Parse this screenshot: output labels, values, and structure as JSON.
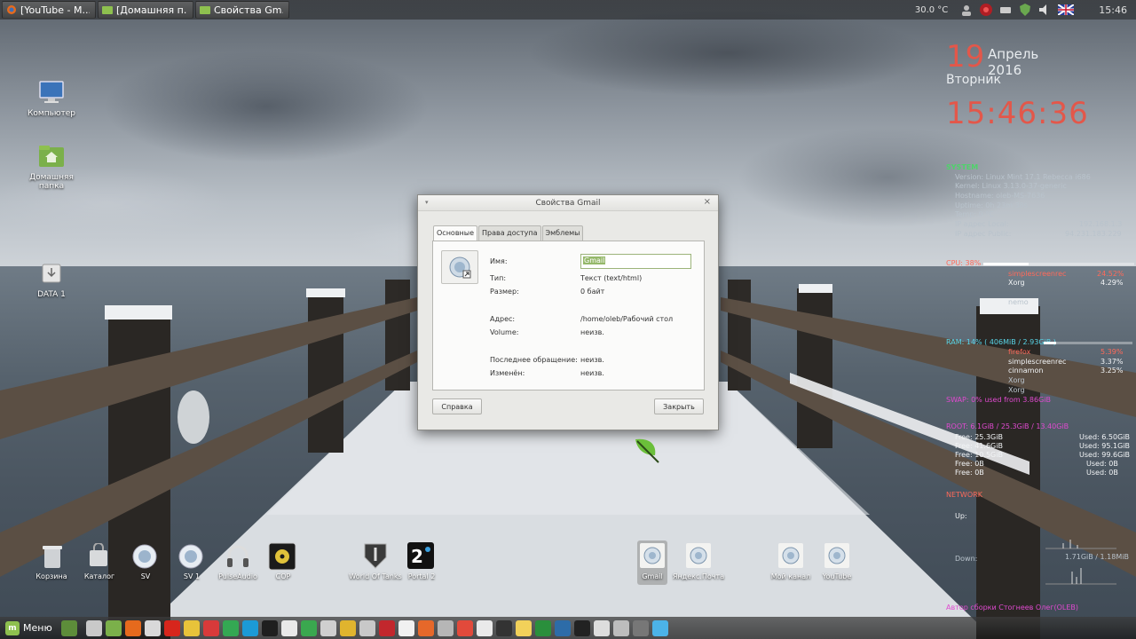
{
  "top_panel": {
    "windows": [
      {
        "label": "[YouTube - M..."
      },
      {
        "label": "[Домашняя п..."
      },
      {
        "label": "Свойства Gm..."
      }
    ],
    "temperature": "30.0 °C",
    "time": "15:46"
  },
  "desktop_icons": [
    {
      "label": "Компьютер"
    },
    {
      "label": "Домашняя папка"
    },
    {
      "label": "DATA 1"
    }
  ],
  "dialog": {
    "title": "Свойства Gmail",
    "tabs": [
      {
        "label": "Основные"
      },
      {
        "label": "Права доступа"
      },
      {
        "label": "Эмблемы"
      }
    ],
    "fields": {
      "name_label": "Имя:",
      "name_value": "Gmail",
      "type_label": "Тип:",
      "type_value": "Текст (text/html)",
      "size_label": "Размер:",
      "size_value": "0 байт",
      "address_label": "Адрес:",
      "address_value": "/home/oleb/Рабочий стол",
      "volume_label": "Volume:",
      "volume_value": "неизв.",
      "accessed_label": "Последнее обращение:",
      "accessed_value": "неизв.",
      "modified_label": "Изменён:",
      "modified_value": "неизв."
    },
    "help_button": "Справка",
    "close_button": "Закрыть"
  },
  "conky": {
    "day": "19",
    "month_year": "Апрель 2016",
    "weekday": "Вторник",
    "clock": "15:46:36",
    "system_header": "SYSTEM",
    "version": "Version: Linux Mint 17.1 Rebecca i686",
    "kernel": "Kernel: Linux 3.13.0-37-generic",
    "hostname": "Hostname: oleb-MS-7636",
    "uptime": "Uptime: 0h 23m 38s",
    "temp": "Temp: 0   °C",
    "ip_local_label": "IP адрес Local:",
    "ip_local_value": "192.168.1.3",
    "ip_public_label": "IP адрес Public:",
    "ip_public_value": "94.231.183.229",
    "cpu_header": "CPU: 38%",
    "cpu_procs": [
      {
        "name": "simplescreenrec",
        "value": "24.52%"
      },
      {
        "name": "Xorg",
        "value": "4.29%"
      },
      {
        "name": "nemo",
        "value": ""
      }
    ],
    "ram_header": "RAM: 14% ( 406MiB / 2.93GiB )",
    "ram_procs": [
      {
        "name": "firefox",
        "value": "5.39%"
      },
      {
        "name": "simplescreenrec",
        "value": "3.37%"
      },
      {
        "name": "cinnamon",
        "value": "3.25%"
      },
      {
        "name": "Xorg",
        "value": ""
      },
      {
        "name": "Xorg",
        "value": ""
      }
    ],
    "swap_header": "SWAP: 0%   used from 3.86GiB",
    "disk_header": "ROOT: 6.1GiB / 25.3GiB / 13.40GiB",
    "disk_rows": [
      {
        "left": "Free: 25.3GiB",
        "right": "Used: 6.50GiB"
      },
      {
        "left": "Free: 41.6GiB",
        "right": "Used: 95.1GiB"
      },
      {
        "left": "Free: 10.5GiB",
        "right": "Used: 99.6GiB"
      },
      {
        "left": "Free: 0B",
        "right": "Used: 0B"
      },
      {
        "left": "Free: 0B",
        "right": "Used: 0B"
      }
    ],
    "net_header": "NETWORK",
    "up_label": "Up:",
    "down_label": "Down:",
    "net_totals": "1.71GiB / 1.18MiB",
    "credit": "Автор сборки Стогнеев Олег(OLEB)"
  },
  "dock": [
    {
      "label": "Корзина"
    },
    {
      "label": "Каталог"
    },
    {
      "label": "SV"
    },
    {
      "label": "SV 1"
    },
    {
      "label": "PulseAudio"
    },
    {
      "label": "СОР"
    },
    {
      "label": "World Of Tanks"
    },
    {
      "label": "Portal 2"
    },
    {
      "label": "Gmail"
    },
    {
      "label": "Яндекс.Почта"
    },
    {
      "label": "Мой канал"
    },
    {
      "label": "YouTube"
    }
  ],
  "bottom_panel": {
    "menu_label": "Меню"
  },
  "colors": {
    "accent_red": "#e3574a",
    "mint_green": "#8ec04f",
    "conky_green": "#4fd36b"
  }
}
